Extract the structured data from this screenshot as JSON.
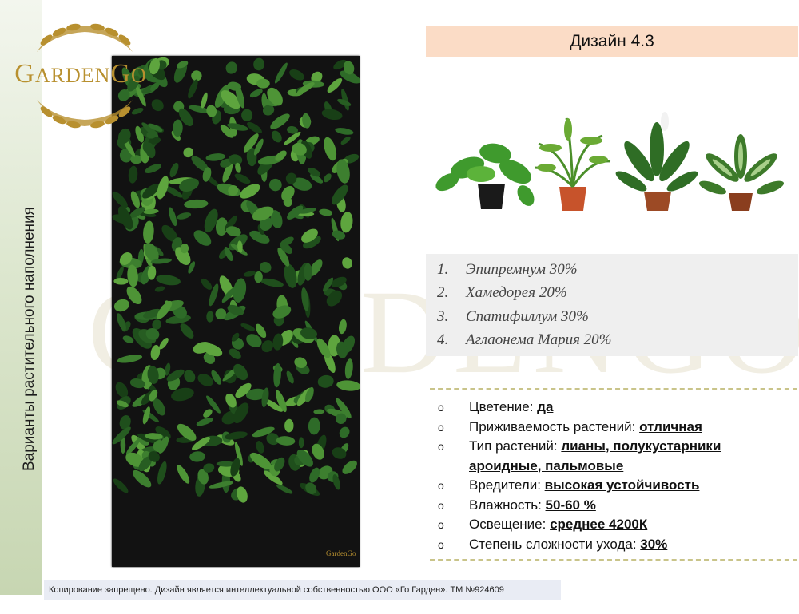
{
  "sidebar": {
    "title": "Варианты растительного наполнения"
  },
  "logo": {
    "brand": "GardenGo",
    "text_big_1": "G",
    "text_small_1": "ARDEN",
    "text_big_2": "G",
    "text_small_2": "O"
  },
  "watermark": {
    "text": "GARDENGO"
  },
  "header": {
    "design_title": "Дизайн 4.3"
  },
  "wall": {
    "badge": "GardenGo"
  },
  "plants_list": [
    {
      "num": "1.",
      "name": "Эпипремнум 30%"
    },
    {
      "num": "2.",
      "name": "Хамедорея 20%"
    },
    {
      "num": "3.",
      "name": "Спатифиллум 30%"
    },
    {
      "num": "4.",
      "name": "Аглаонема Мария 20%"
    }
  ],
  "properties": [
    {
      "bullet": "o",
      "label": "Цветение: ",
      "value": "да"
    },
    {
      "bullet": "o",
      "label": "Приживаемость растений: ",
      "value": "отличная"
    },
    {
      "bullet": "o",
      "label": "Тип растений: ",
      "value": "лианы, полукустарники",
      "value2": "ароидные, пальмовые"
    },
    {
      "bullet": "o",
      "label": "Вредители: ",
      "value": "высокая устойчивость"
    },
    {
      "bullet": "o",
      "label": "Влажность: ",
      "value": "50-60 %"
    },
    {
      "bullet": "o",
      "label": "Освещение: ",
      "value": "среднее 4200К"
    },
    {
      "bullet": "o",
      "label": "Степень сложности ухода: ",
      "value": "30%"
    }
  ],
  "footer": {
    "copyright": "Копирование запрещено. Дизайн является интеллектуальной собственностью ООО «Го Гарден». ТМ №924609"
  },
  "colors": {
    "accent_gold": "#b8902f",
    "header_bar": "#fbdcc6",
    "list_bg": "#efefef",
    "sidebar_green": "#c7d6b2",
    "footer_bg": "#e9ecf4",
    "plant_green": "#2e6b28"
  }
}
